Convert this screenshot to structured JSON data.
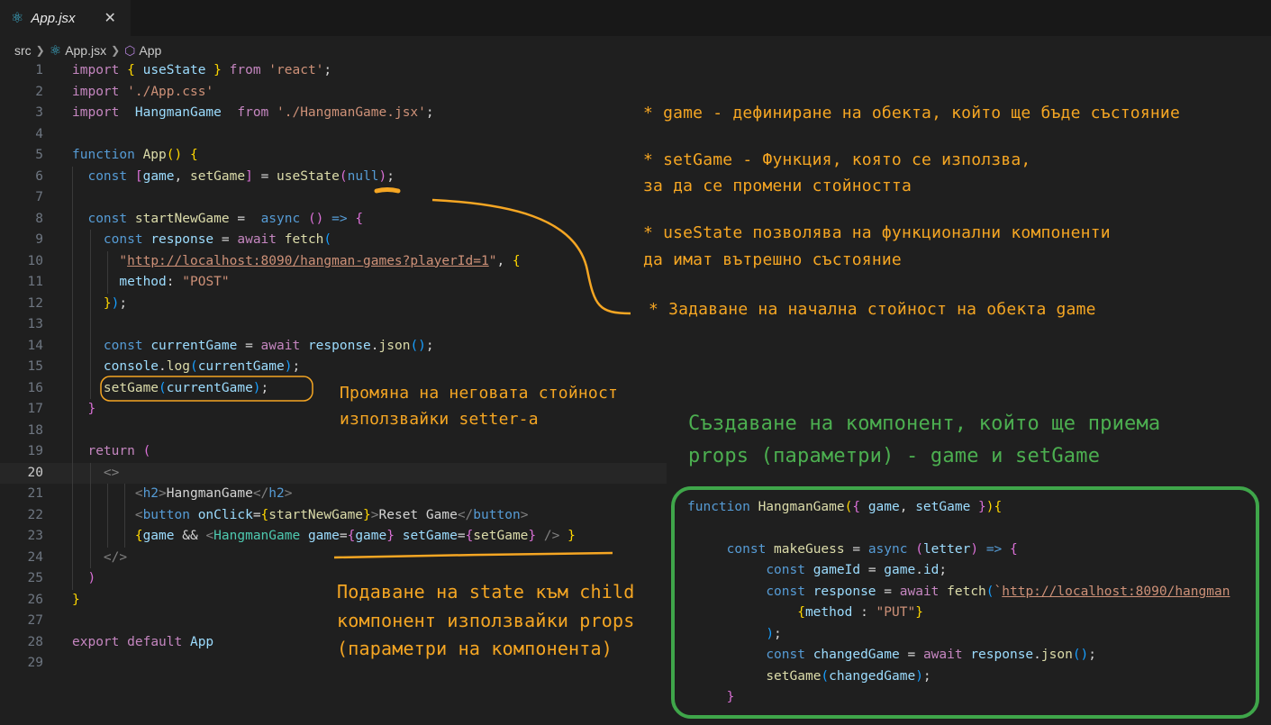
{
  "tab": {
    "title": "App.jsx",
    "close": "✕"
  },
  "breadcrumb": {
    "folder": "src",
    "file": "App.jsx",
    "symbol": "App"
  },
  "line_numbers": [
    "1",
    "2",
    "3",
    "4",
    "5",
    "6",
    "7",
    "8",
    "9",
    "10",
    "11",
    "12",
    "13",
    "14",
    "15",
    "16",
    "17",
    "18",
    "19",
    "20",
    "21",
    "22",
    "23",
    "24",
    "25",
    "26",
    "27",
    "28",
    "29"
  ],
  "current_line": "20",
  "notes": {
    "game_def": "* game - дефиниране на обекта, който ще бъде състояние",
    "setgame_1": "* setGame - Функция, която се използва,",
    "setgame_2": "за да се промени стойността",
    "usestate_1": "* useState позволява на функционални компоненти",
    "usestate_2": "да имат вътрешно състояние",
    "initial": "* Задаване на начална стойност на обекта game",
    "change_1": "Промяна на неговата стойност",
    "change_2": "използвайки setter-а",
    "create_1": "Създаване на компонент, който ще приема",
    "create_2": "props (параметри) - game и setGame",
    "pass_1": "Подаване на state към child",
    "pass_2": "компонент използвайки props",
    "pass_3": "(параметри на компонента)"
  },
  "colors": {
    "annotation": "#f5a623",
    "green_note": "#4caf50",
    "green_box": "#3fa64a"
  }
}
